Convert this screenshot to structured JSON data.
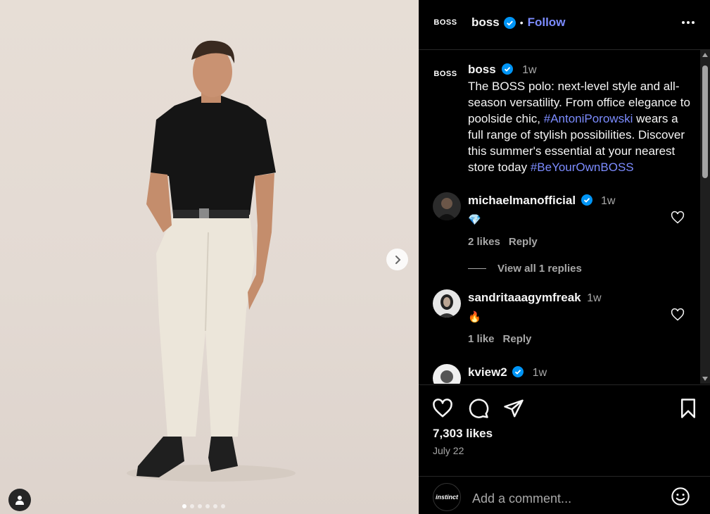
{
  "post": {
    "username": "boss",
    "avatar_text": "BOSS",
    "follow_label": "Follow",
    "separator": "•",
    "caption_age": "1w",
    "caption_text": "The BOSS polo: next-level style and all-season versatility. From office elegance to poolside chic, ",
    "caption_tag1": "#AntoniPorowski",
    "caption_mid": " wears a full range of stylish possibilities. Discover this summer's essential at your nearest store today ",
    "caption_tag2": "#BeYourOwnBOSS",
    "likes": "7,303 likes",
    "date": "July 22",
    "slides_total": 6,
    "slide_active": 1
  },
  "comments": [
    {
      "username": "michaelmanofficial",
      "age": "1w",
      "emoji": "💎",
      "likes": "2 likes",
      "reply": "Reply",
      "verified": true
    },
    {
      "username": "sandritaaagymfreak",
      "age": "1w",
      "emoji": "🔥",
      "likes": "1 like",
      "reply": "Reply",
      "verified": false
    },
    {
      "username": "kview2",
      "age": "1w",
      "verified": true
    }
  ],
  "view_replies": "View all 1 replies",
  "composer": {
    "avatar_text": "instinct",
    "placeholder": "Add a comment..."
  },
  "colors": {
    "link": "#7c8cff",
    "verified": "#0095f6",
    "muted": "#a8a8a8"
  }
}
